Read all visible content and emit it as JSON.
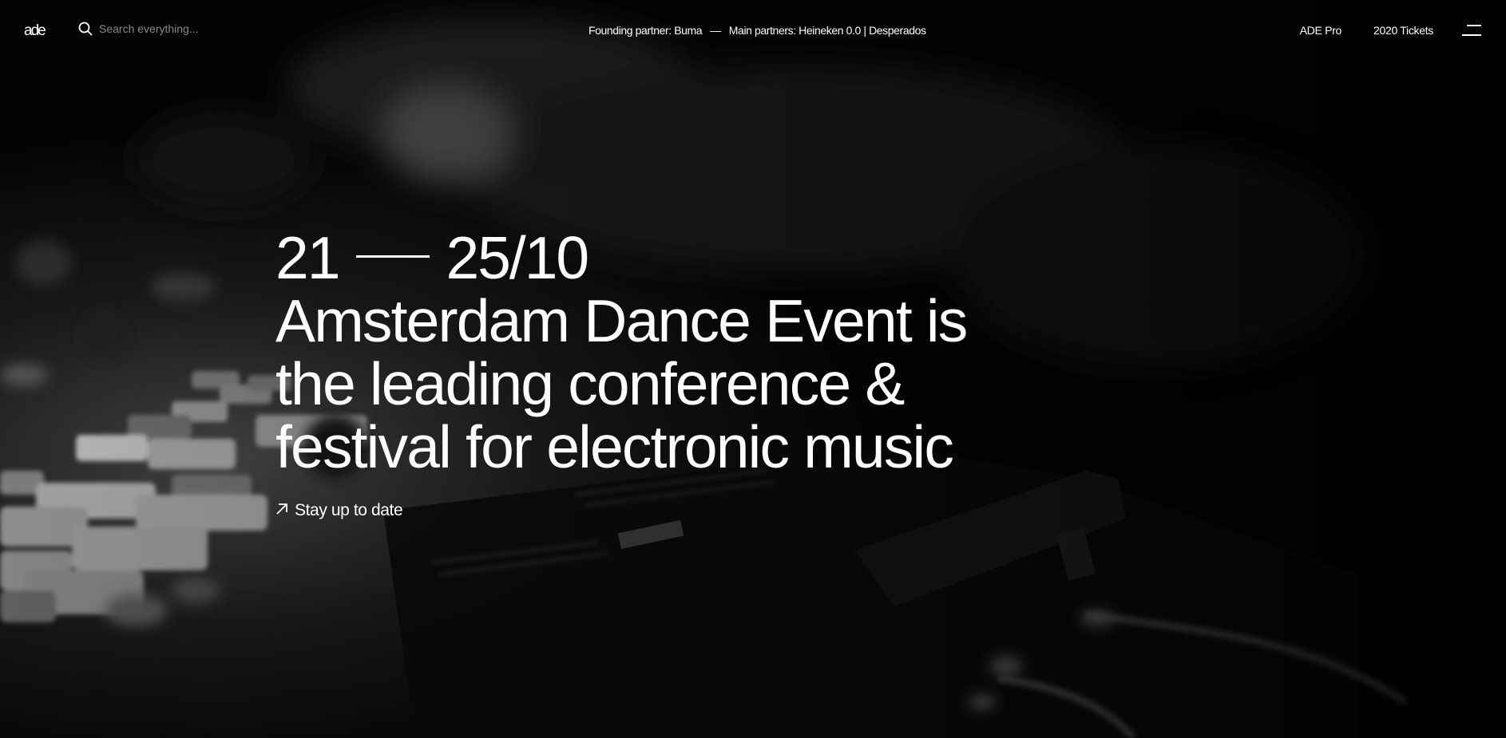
{
  "header": {
    "logo_text": "ade",
    "search": {
      "placeholder": "Search everything..."
    },
    "partners": {
      "founding": "Founding partner: Buma",
      "separator": "—",
      "main": "Main partners: Heineken 0.0 | Desperados"
    },
    "nav": {
      "pro": "ADE Pro",
      "tickets": "2020 Tickets"
    },
    "icons": {
      "search": "search-icon",
      "menu": "hamburger-menu-icon"
    }
  },
  "hero": {
    "date_start": "21",
    "date_end": "25/10",
    "headline_lines": [
      "Amsterdam Dance Event is",
      "the leading conference &",
      "festival for electronic music"
    ],
    "cta_label": "Stay up to date",
    "cta_icon": "arrow-up-right-icon"
  },
  "colors": {
    "background": "#000000",
    "text": "#ffffff",
    "placeholder": "#8a8a8a"
  }
}
